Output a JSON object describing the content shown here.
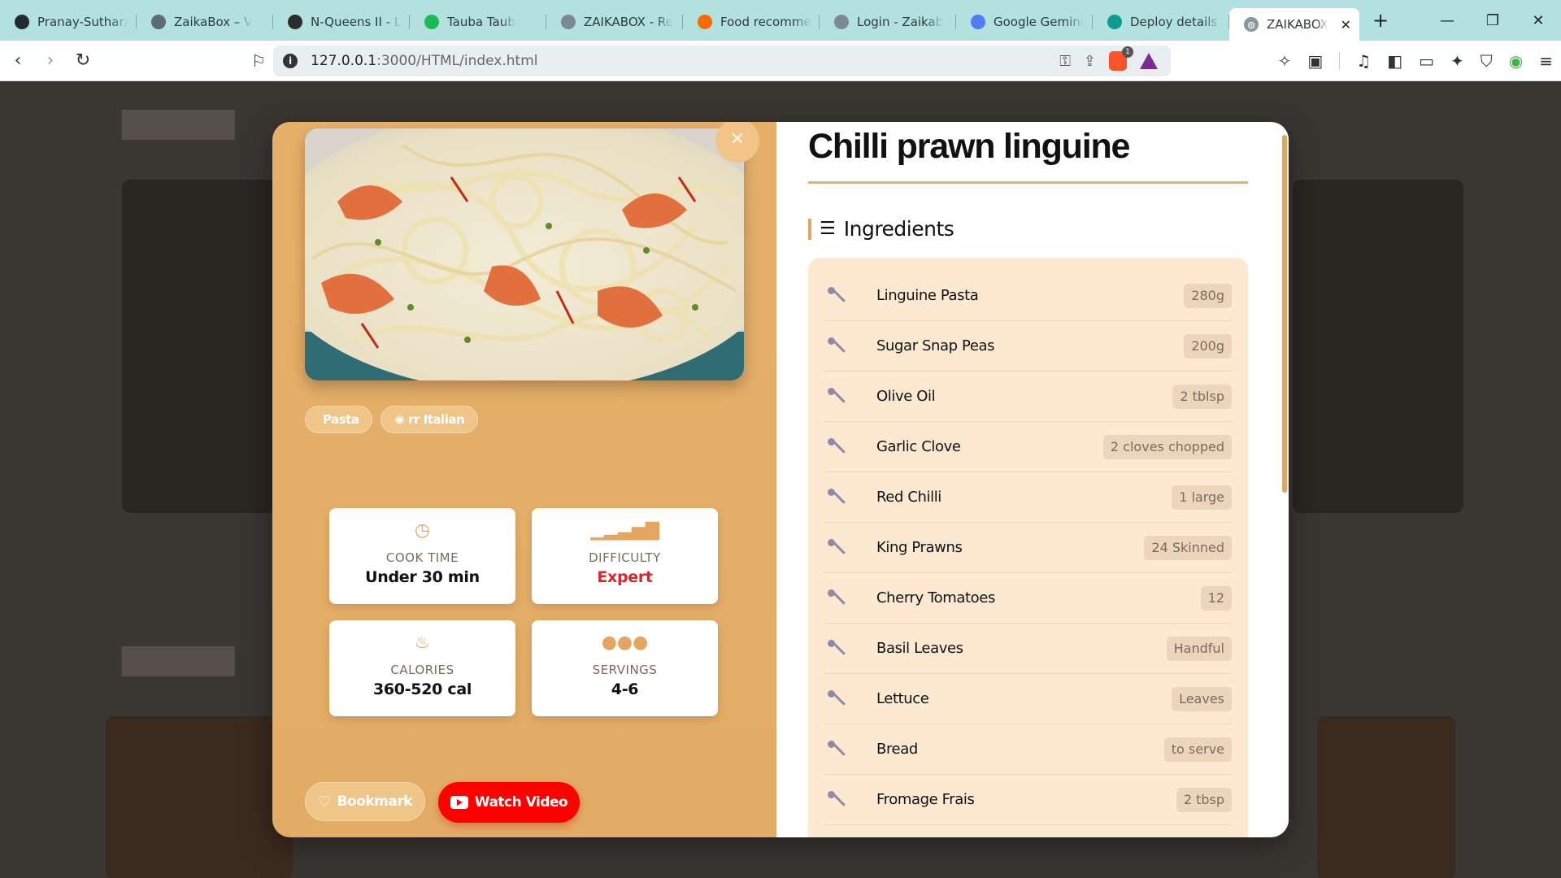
{
  "browser": {
    "tabs": [
      {
        "title": "Pranay-Suthar/",
        "icon": "github-icon",
        "color": "#24292e"
      },
      {
        "title": "ZaikaBox – V",
        "icon": "search-icon",
        "color": "#5f6b7a"
      },
      {
        "title": "N-Queens II - Le",
        "icon": "leetcode-icon",
        "color": "#2d2d2d"
      },
      {
        "title": "Tauba Taub",
        "icon": "spotify-icon",
        "color": "#1db954"
      },
      {
        "title": "ZAIKABOX - Re",
        "icon": "globe-icon",
        "color": "#7b8a95"
      },
      {
        "title": "Food recomme",
        "icon": "fire-icon",
        "color": "#ff6a00"
      },
      {
        "title": "Login - Zaikab",
        "icon": "globe-icon",
        "color": "#7b8a95"
      },
      {
        "title": "Google Gemini",
        "icon": "gemini-icon",
        "color": "#4f7df3"
      },
      {
        "title": "Deploy details |",
        "icon": "netlify-icon",
        "color": "#0e9c8e"
      }
    ],
    "active_tab": {
      "title": "ZAIKABOX",
      "close": "✕"
    },
    "url_host": "127.0.0.1",
    "url_path": ":3000/HTML/index.html",
    "shield_badge": "1"
  },
  "recipe": {
    "title": "Chilli prawn linguine",
    "close": "×",
    "tags": [
      {
        "label": "Pasta",
        "icon": "tag-icon"
      },
      {
        "label": "rr Italian",
        "icon": "globe-icon"
      }
    ],
    "stats": [
      {
        "key": "cook-time",
        "label": "COOK TIME",
        "value": "Under 30 min",
        "icon": "clock-icon"
      },
      {
        "key": "difficulty",
        "label": "DIFFICULTY",
        "value": "Expert",
        "icon": "signal-icon"
      },
      {
        "key": "calories",
        "label": "CALORIES",
        "value": "360-520 cal",
        "icon": "flame-icon"
      },
      {
        "key": "servings",
        "label": "SERVINGS",
        "value": "4-6",
        "icon": "users-icon"
      }
    ],
    "bookmark_label": "Bookmark",
    "video_label": "Watch Video",
    "ingredients_heading": "Ingredients",
    "ingredients": [
      {
        "name": "Linguine Pasta",
        "qty": "280g"
      },
      {
        "name": "Sugar Snap Peas",
        "qty": "200g"
      },
      {
        "name": "Olive Oil",
        "qty": "2 tblsp"
      },
      {
        "name": "Garlic Clove",
        "qty": "2 cloves chopped"
      },
      {
        "name": "Red Chilli",
        "qty": "1 large"
      },
      {
        "name": "King Prawns",
        "qty": "24 Skinned"
      },
      {
        "name": "Cherry Tomatoes",
        "qty": "12"
      },
      {
        "name": "Basil Leaves",
        "qty": "Handful"
      },
      {
        "name": "Lettuce",
        "qty": "Leaves"
      },
      {
        "name": "Bread",
        "qty": "to serve"
      },
      {
        "name": "Fromage Frais",
        "qty": "2 tbsp"
      }
    ]
  },
  "colors": {
    "accent": "#e4a55f",
    "video": "#fe0000",
    "expert": "#d8262b"
  }
}
